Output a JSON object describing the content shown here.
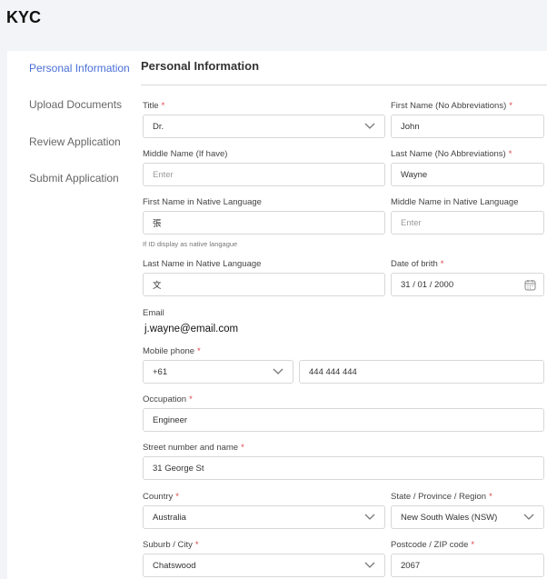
{
  "app": {
    "title": "KYC"
  },
  "steps": [
    {
      "label": "Personal Information",
      "active": true
    },
    {
      "label": "Upload Documents",
      "active": false
    },
    {
      "label": "Review Application",
      "active": false
    },
    {
      "label": "Submit Application",
      "active": false
    }
  ],
  "section": {
    "title": "Personal Information"
  },
  "colors": {
    "accent": "#4a6fd6",
    "required": "#e0434b",
    "border": "#d7d7d7"
  },
  "form": {
    "title": {
      "label": "Title",
      "required": true,
      "value": "Dr."
    },
    "first_name": {
      "label": "First Name (No Abbreviations)",
      "required": true,
      "value": "John"
    },
    "middle_name": {
      "label": "Middle Name (If have)",
      "placeholder": "Enter"
    },
    "last_name": {
      "label": "Last Name (No Abbreviations)",
      "required": true,
      "value": "Wayne"
    },
    "first_name_native": {
      "label": "First Name in Native Language",
      "value": "張",
      "hint": "If ID display as native langague"
    },
    "middle_name_native": {
      "label": "Middle Name in Native Language",
      "placeholder": "Enter"
    },
    "last_name_native": {
      "label": "Last Name in Native Language",
      "value": "文"
    },
    "dob": {
      "label": "Date of brith",
      "required": true,
      "value": "31 / 01 / 2000",
      "icon": "calendar-icon"
    },
    "email": {
      "label": "Email",
      "value": "j.wayne@email.com"
    },
    "mobile": {
      "label": "Mobile phone",
      "required": true,
      "code": "+61",
      "number": "444 444 444"
    },
    "occupation": {
      "label": "Occupation",
      "required": true,
      "value": "Engineer"
    },
    "street": {
      "label": "Street number and name",
      "required": true,
      "value": "31 George St"
    },
    "country": {
      "label": "Country",
      "required": true,
      "value": "Australia"
    },
    "state": {
      "label": "State / Province / Region",
      "required": true,
      "value": "New South Wales (NSW)"
    },
    "suburb": {
      "label": "Suburb / City",
      "required": true,
      "value": "Chatswood"
    },
    "postcode": {
      "label": "Postcode / ZIP code",
      "required": true,
      "value": "2067"
    },
    "required_mark": "*"
  }
}
